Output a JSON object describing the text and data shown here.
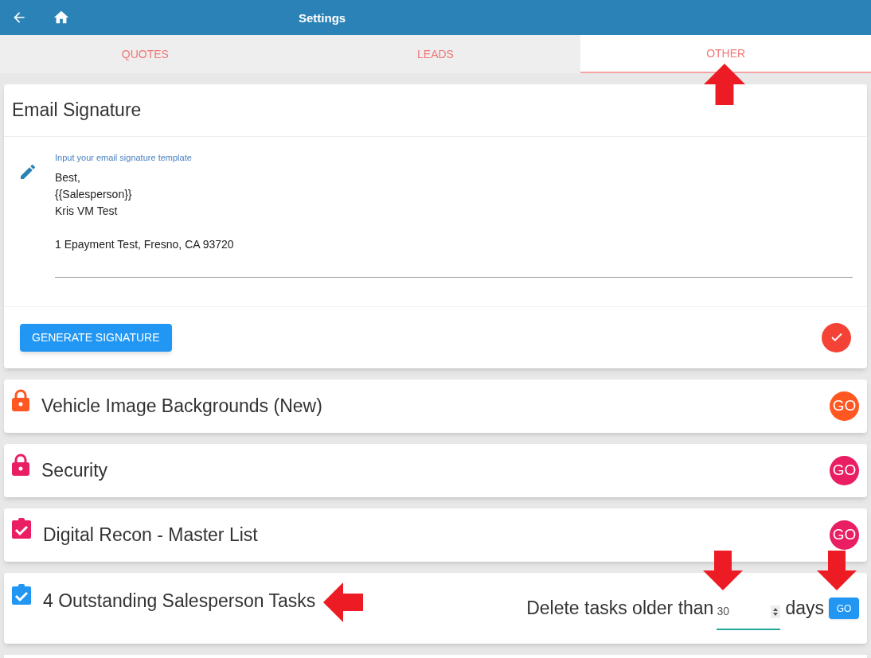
{
  "header": {
    "title": "Settings"
  },
  "tabs": [
    {
      "label": "QUOTES",
      "selected": false
    },
    {
      "label": "LEADS",
      "selected": false
    },
    {
      "label": "OTHER",
      "selected": true
    }
  ],
  "email_signature": {
    "title": "Email Signature",
    "label": "Input your email signature template",
    "value": "Best,\n{{Salesperson}}\nKris VM Test\n\n1 Epayment Test, Fresno, CA 93720",
    "button": "GENERATE SIGNATURE"
  },
  "sections": [
    {
      "kind": "lock",
      "title": "Vehicle Image Backgrounds (New)",
      "color": "#ff5722",
      "button": "GO"
    },
    {
      "kind": "lock",
      "title": "Security",
      "color": "#e91e63",
      "button": "GO"
    },
    {
      "kind": "clipboard",
      "title": "Digital Recon - Master List",
      "color": "#e91e63",
      "button": "GO"
    },
    {
      "kind": "tasks",
      "title": "4 Outstanding Salesperson Tasks",
      "color": "#2196f3",
      "prefix": "Delete tasks older than",
      "days_value": "30",
      "suffix": "days",
      "button": "GO"
    }
  ]
}
